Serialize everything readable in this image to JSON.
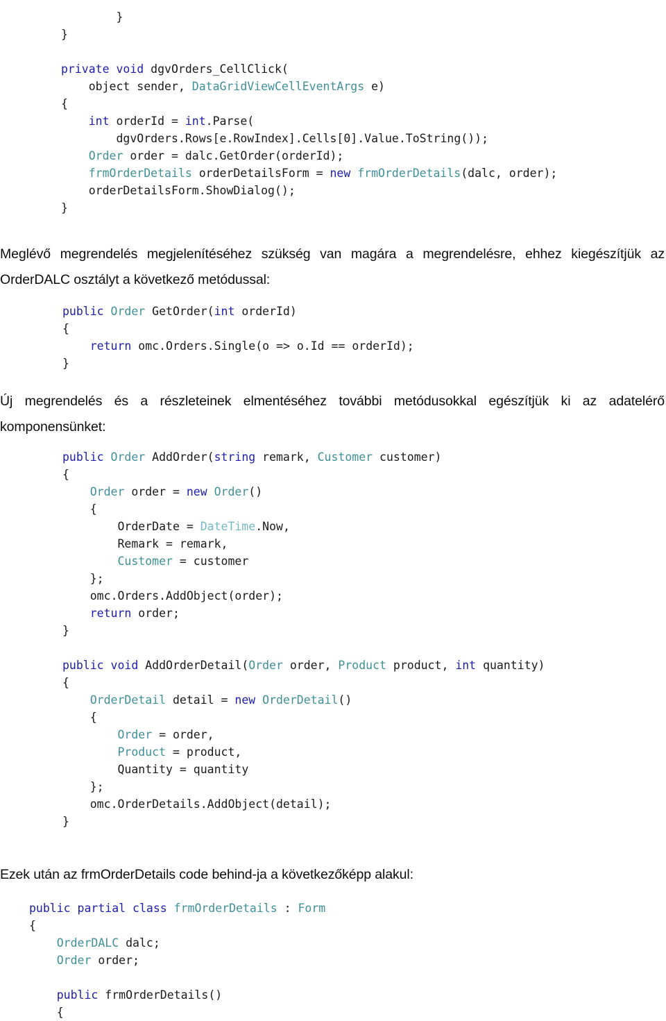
{
  "document": {
    "language": "hu",
    "kind": "tutorial-page",
    "colors": {
      "text": "#0d0d0d",
      "code_plain": "#1a1a1a",
      "keyword": "#2020b0",
      "type": "#3f9199",
      "framework_type": "#73b9c1",
      "background": "#ffffff"
    }
  },
  "blocks": {
    "code_cellclick": {
      "name": "dgvOrders_CellClick event handler",
      "lines": [
        "        }",
        "}",
        "",
        "private void dgvOrders_CellClick(",
        "    object sender, DataGridViewCellEventArgs e)",
        "{",
        "    int orderId = int.Parse(",
        "        dgvOrders.Rows[e.RowIndex].Cells[0].Value.ToString());",
        "    Order order = dalc.GetOrder(orderId);",
        "    frmOrderDetails orderDetailsForm = new frmOrderDetails(dalc, order);",
        "    orderDetailsForm.ShowDialog();",
        "}"
      ]
    },
    "para_getorder": {
      "text": "Meglévő megrendelés megjelenítéséhez szükség van magára a megrendelésre, ehhez kiegészítjük az OrderDALC osztályt a következő metódussal:"
    },
    "code_getorder": {
      "name": "OrderDALC.GetOrder method",
      "lines": [
        "public Order GetOrder(int orderId)",
        "{",
        "    return omc.Orders.Single(o => o.Id == orderId);",
        "}"
      ]
    },
    "para_addorder": {
      "text": "Új megrendelés és a részleteinek elmentéséhez további metódusokkal egészítjük ki az adatelérő komponensünket:"
    },
    "code_addorder": {
      "name": "OrderDALC.AddOrder and AddOrderDetail methods",
      "lines": [
        "public Order AddOrder(string remark, Customer customer)",
        "{",
        "    Order order = new Order()",
        "    {",
        "        OrderDate = DateTime.Now,",
        "        Remark = remark,",
        "        Customer = customer",
        "    };",
        "    omc.Orders.AddObject(order);",
        "    return order;",
        "}",
        "",
        "public void AddOrderDetail(Order order, Product product, int quantity)",
        "{",
        "    OrderDetail detail = new OrderDetail()",
        "    {",
        "        Order = order,",
        "        Product = product,",
        "        Quantity = quantity",
        "    };",
        "    omc.OrderDetails.AddObject(detail);",
        "}"
      ]
    },
    "para_codebehind": {
      "text": "Ezek után az frmOrderDetails code behind-ja a következőképp alakul:"
    },
    "code_codebehind": {
      "name": "frmOrderDetails partial class",
      "lines": [
        "public partial class frmOrderDetails : Form",
        "{",
        "    OrderDALC dalc;",
        "    Order order;",
        "",
        "    public frmOrderDetails()",
        "    {"
      ]
    }
  }
}
